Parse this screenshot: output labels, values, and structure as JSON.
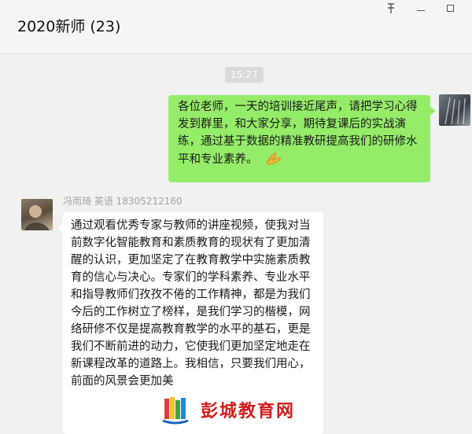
{
  "window": {
    "title": "2020新师 (23)"
  },
  "chat": {
    "timestamp": "15:27",
    "messages": [
      {
        "side": "right",
        "text": "各位老师，一天的培训接近尾声，请把学习心得发到群里，和大家分享，期待复课后的实战演练，通过基于数据的精准教研提高我们的研修水平和专业素养。",
        "emoji": "clapping-hands-icon"
      },
      {
        "side": "left",
        "sender": "冯雨琦 英语 18305212160",
        "text": "通过观看优秀专家与教师的讲座视频，使我对当前数字化智能教育和素质教育的现状有了更加清醒的认识，更加坚定了在教育教学中实施素质教育的信心与决心。专家们的学科素养、专业水平和指导教师们孜孜不倦的工作精神，都是为我们今后的工作树立了榜样，是我们学习的楷模，网络研修不仅是提高教育教学的水平的基石，更是我们不断前进的动力，它使我们更加坚定地走在新课程改革的道路上。我相信，只要我们用心，前面的风景会更加美"
      }
    ]
  },
  "watermark": {
    "text": "彭城教育网"
  },
  "colors": {
    "self_bubble": "#95ec69",
    "other_bubble": "#ffffff",
    "background": "#f1f1f1"
  }
}
